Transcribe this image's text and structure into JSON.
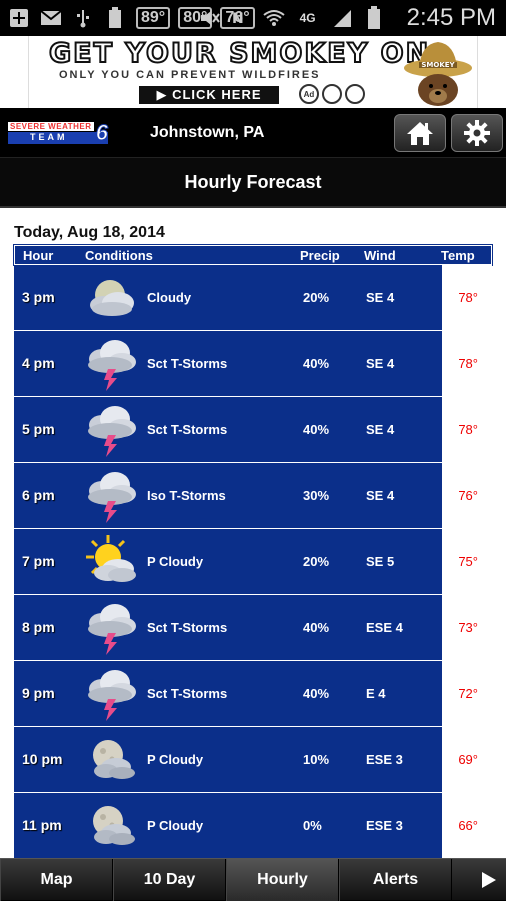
{
  "status_bar": {
    "temps": [
      "89°",
      "80°",
      "76°"
    ],
    "battery_label": "100",
    "network": "4G",
    "time": "2:45 PM"
  },
  "ad": {
    "headline": "GET YOUR SMOKEY ON",
    "subline": "ONLY YOU CAN PREVENT WILDFIRES",
    "cta": "▶ CLICK HERE",
    "logos": [
      "Ad",
      "",
      ""
    ],
    "hat_text": "SMOKEY"
  },
  "header": {
    "logo_top": "SEVERE WEATHER",
    "logo_team": "TEAM",
    "logo_number": "6",
    "location": "Johnstown, PA"
  },
  "page_title": "Hourly Forecast",
  "date_label": "Today, Aug 18, 2014",
  "columns": {
    "hour": "Hour",
    "conditions": "Conditions",
    "precip": "Precip",
    "wind": "Wind",
    "temp": "Temp"
  },
  "rows": [
    {
      "hour": "3 pm",
      "icon": "cloudy-icon",
      "conditions": "Cloudy",
      "precip": "20%",
      "wind": "SE 4",
      "temp": "78°"
    },
    {
      "hour": "4 pm",
      "icon": "thunderstorm-icon",
      "conditions": "Sct T-Storms",
      "precip": "40%",
      "wind": "SE 4",
      "temp": "78°"
    },
    {
      "hour": "5 pm",
      "icon": "thunderstorm-icon",
      "conditions": "Sct T-Storms",
      "precip": "40%",
      "wind": "SE 4",
      "temp": "78°"
    },
    {
      "hour": "6 pm",
      "icon": "thunderstorm-icon",
      "conditions": "Iso T-Storms",
      "precip": "30%",
      "wind": "SE 4",
      "temp": "76°"
    },
    {
      "hour": "7 pm",
      "icon": "partly-sunny-icon",
      "conditions": "P Cloudy",
      "precip": "20%",
      "wind": "SE 5",
      "temp": "75°"
    },
    {
      "hour": "8 pm",
      "icon": "thunderstorm-icon",
      "conditions": "Sct T-Storms",
      "precip": "40%",
      "wind": "ESE 4",
      "temp": "73°"
    },
    {
      "hour": "9 pm",
      "icon": "thunderstorm-icon",
      "conditions": "Sct T-Storms",
      "precip": "40%",
      "wind": "E 4",
      "temp": "72°"
    },
    {
      "hour": "10 pm",
      "icon": "partly-cloudy-night-icon",
      "conditions": "P Cloudy",
      "precip": "10%",
      "wind": "ESE 3",
      "temp": "69°"
    },
    {
      "hour": "11 pm",
      "icon": "partly-cloudy-night-icon",
      "conditions": "P Cloudy",
      "precip": "0%",
      "wind": "ESE 3",
      "temp": "66°"
    }
  ],
  "tabs": [
    {
      "label": "Map",
      "active": false
    },
    {
      "label": "10 Day",
      "active": false
    },
    {
      "label": "Hourly",
      "active": true
    },
    {
      "label": "Alerts",
      "active": false
    }
  ],
  "colors": {
    "table_blue": "#0b2f8a",
    "temp_red": "#e00000"
  }
}
